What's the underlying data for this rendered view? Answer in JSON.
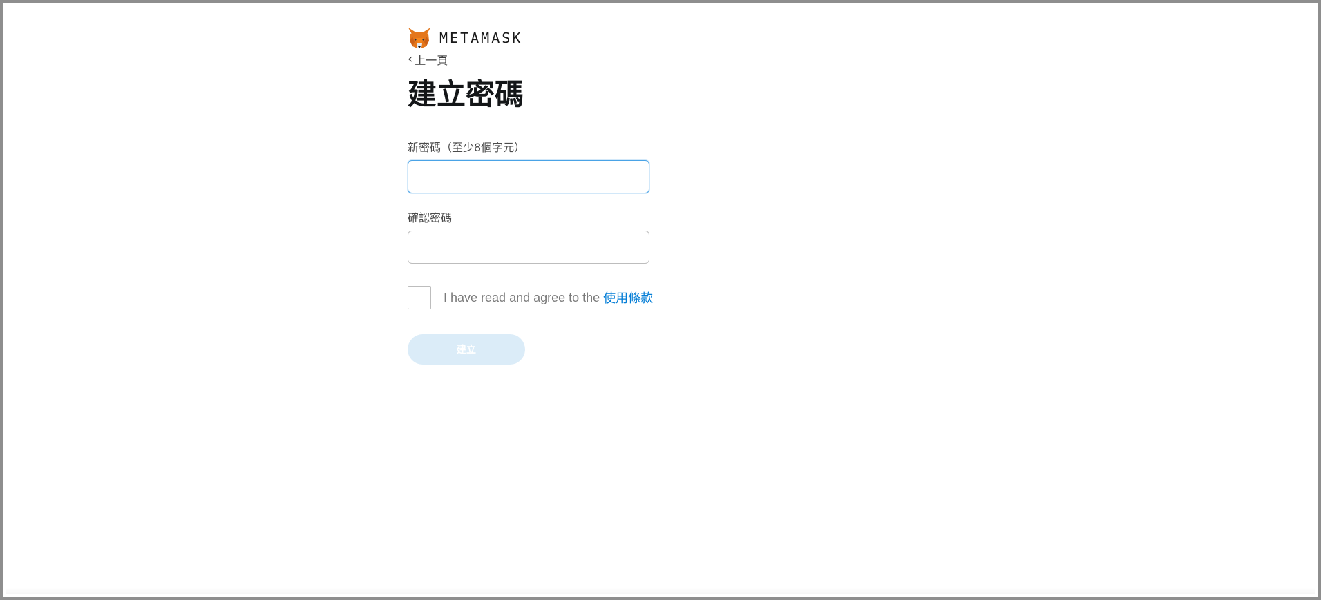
{
  "brand": {
    "wordmark": "METAMASK",
    "logo_icon": "metamask-fox-icon"
  },
  "nav": {
    "back_label": "上一頁",
    "back_icon": "chevron-left-icon"
  },
  "page": {
    "title": "建立密碼"
  },
  "form": {
    "new_password": {
      "label": "新密碼（至少8個字元）",
      "value": "",
      "focused": true
    },
    "confirm_password": {
      "label": "確認密碼",
      "value": ""
    },
    "terms": {
      "checked": false,
      "text": "I have read and agree to the",
      "link_label": "使用條款"
    },
    "submit": {
      "label": "建立",
      "enabled": false
    }
  },
  "colors": {
    "link": "#037dd6",
    "focus_border": "#4aa3e6",
    "disabled_button": "#dbecf8",
    "fox_orange": "#e2761b"
  }
}
